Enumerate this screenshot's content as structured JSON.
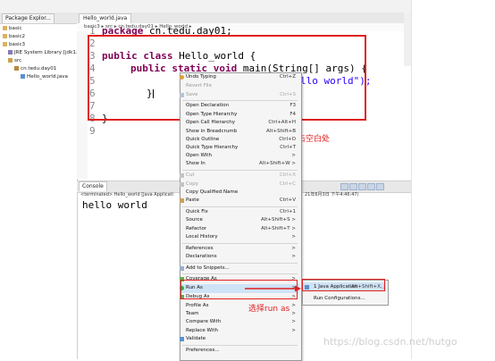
{
  "package_explorer": {
    "tab_label": "Package Explor...",
    "items": [
      {
        "label": "basic"
      },
      {
        "label": "basic2"
      },
      {
        "label": "basic3"
      },
      {
        "label": "JRE System Library [jdk1.8"
      },
      {
        "label": "src"
      },
      {
        "label": "cn.tedu.day01"
      },
      {
        "label": "Hello_world.java"
      }
    ]
  },
  "editor": {
    "tab_label": "Hello_world.java",
    "breadcrumb": "basic3 ▸ src ▸ cn.tedu.day01 ▸ Hello_world ▸",
    "line_numbers": [
      "1",
      "2",
      "3",
      "4",
      "5",
      "6",
      "7",
      "8",
      "9"
    ],
    "code": {
      "l1_kw": "package",
      "l1_rest": " cn.tedu.day01;",
      "l3_kw": "public class",
      "l3_rest": " Hello_world {",
      "l4_kw": "public static void",
      "l4_rest": " main(String[] args) {",
      "l5_str": "llo world\");",
      "l6": "}",
      "l8": "}"
    },
    "annotation": "鼠标右键单击空白处"
  },
  "console": {
    "tab_label": "Console",
    "status": "<terminated> Hello_world [Java Applicati",
    "status_right": "21年6月3日 下午4:46:47)",
    "output": "hello world"
  },
  "context_menu": {
    "items": [
      {
        "label": "Undo Typing",
        "shortcut": "Ctrl+Z",
        "disabled": false
      },
      {
        "label": "Revert File",
        "shortcut": "",
        "disabled": true
      },
      {
        "label": "Save",
        "shortcut": "Ctrl+S",
        "disabled": true
      },
      {
        "label": "Open Declaration",
        "shortcut": "F3",
        "disabled": false
      },
      {
        "label": "Open Type Hierarchy",
        "shortcut": "F4",
        "disabled": false
      },
      {
        "label": "Open Call Hierarchy",
        "shortcut": "Ctrl+Alt+H",
        "disabled": false
      },
      {
        "label": "Show in Breadcrumb",
        "shortcut": "Alt+Shift+B",
        "disabled": false
      },
      {
        "label": "Quick Outline",
        "shortcut": "Ctrl+O",
        "disabled": false
      },
      {
        "label": "Quick Type Hierarchy",
        "shortcut": "Ctrl+T",
        "disabled": false
      },
      {
        "label": "Open With",
        "shortcut": ">",
        "disabled": false
      },
      {
        "label": "Show In",
        "shortcut": "Alt+Shift+W >",
        "disabled": false
      },
      {
        "label": "Cut",
        "shortcut": "Ctrl+X",
        "disabled": true
      },
      {
        "label": "Copy",
        "shortcut": "Ctrl+C",
        "disabled": true
      },
      {
        "label": "Copy Qualified Name",
        "shortcut": "",
        "disabled": false
      },
      {
        "label": "Paste",
        "shortcut": "Ctrl+V",
        "disabled": false
      },
      {
        "label": "Quick Fix",
        "shortcut": "Ctrl+1",
        "disabled": false
      },
      {
        "label": "Source",
        "shortcut": "Alt+Shift+S >",
        "disabled": false
      },
      {
        "label": "Refactor",
        "shortcut": "Alt+Shift+T >",
        "disabled": false
      },
      {
        "label": "Local History",
        "shortcut": ">",
        "disabled": false
      },
      {
        "label": "References",
        "shortcut": ">",
        "disabled": false
      },
      {
        "label": "Declarations",
        "shortcut": ">",
        "disabled": false
      },
      {
        "label": "Add to Snippets...",
        "shortcut": "",
        "disabled": false
      },
      {
        "label": "Coverage As",
        "shortcut": ">",
        "disabled": false
      },
      {
        "label": "Run As",
        "shortcut": ">",
        "disabled": false
      },
      {
        "label": "Debug As",
        "shortcut": ">",
        "disabled": false
      },
      {
        "label": "Profile As",
        "shortcut": ">",
        "disabled": false
      },
      {
        "label": "Team",
        "shortcut": ">",
        "disabled": false
      },
      {
        "label": "Compare With",
        "shortcut": ">",
        "disabled": false
      },
      {
        "label": "Replace With",
        "shortcut": ">",
        "disabled": false
      },
      {
        "label": "Validate",
        "shortcut": "",
        "disabled": false
      },
      {
        "label": "Preferences...",
        "shortcut": "",
        "disabled": false
      }
    ]
  },
  "run_as_submenu": {
    "items": [
      {
        "label": "1 Java Application",
        "shortcut": "Alt+Shift+X, J"
      },
      {
        "label": "Run Configurations...",
        "shortcut": ""
      }
    ],
    "annotation": "选择run as"
  },
  "watermark": "https://blog.csdn.net/hutgo",
  "colors": {
    "annotation_red": "#e02020",
    "keyword": "#7f0055",
    "string": "#2a00ff",
    "highlight": "#cfe3f7"
  }
}
